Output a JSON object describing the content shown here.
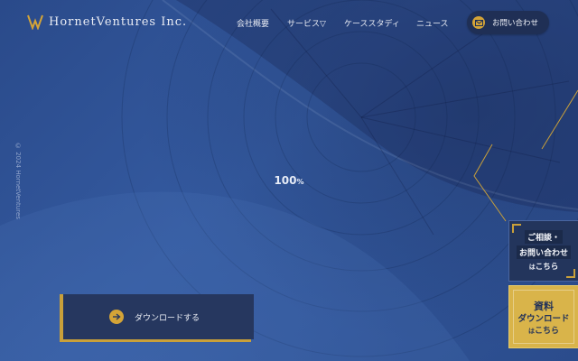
{
  "header": {
    "logo_text": "HornetVentures Inc.",
    "nav": [
      {
        "label": "会社概要"
      },
      {
        "label": "サービス▽"
      },
      {
        "label": "ケーススタディ"
      },
      {
        "label": "ニュース"
      }
    ],
    "contact_label": "お問い合わせ"
  },
  "hero": {
    "copyright": "© 2024 HornetVentures",
    "progress_value": "100",
    "progress_unit": "%"
  },
  "cta": {
    "download_label": "ダウンロードする"
  },
  "side": {
    "consult_line1": "ご相談・",
    "consult_line2": "お問い合わせ",
    "consult_line3_small": "は",
    "consult_line3": "こちら",
    "download_line1": "資料",
    "download_line2": "ダウンロード",
    "download_line3_small": "は",
    "download_line3": "こちら"
  },
  "colors": {
    "accent_gold": "#d4a437",
    "navy": "#26375f",
    "hero_blue": "#2f4f8f"
  },
  "icons": {
    "logo": "w-chevron-logo-icon",
    "contact": "mail-icon",
    "download": "arrow-right-icon"
  }
}
